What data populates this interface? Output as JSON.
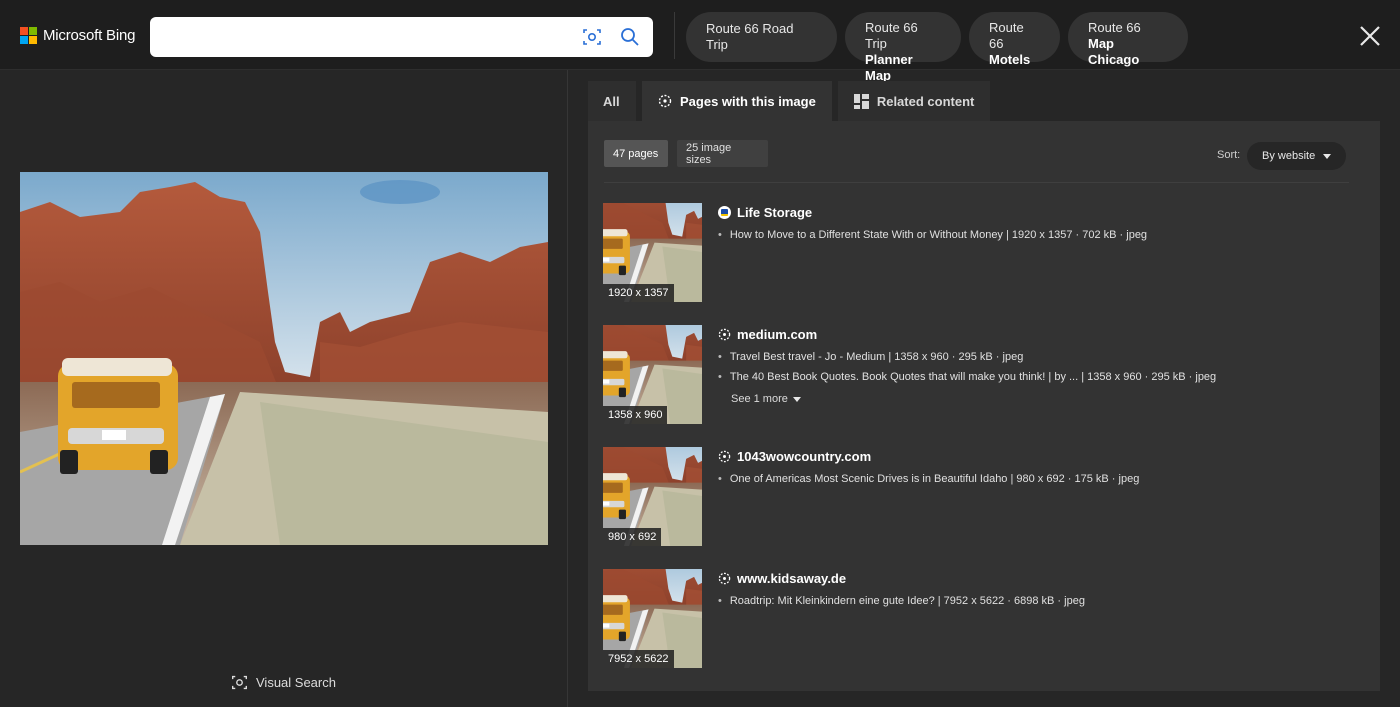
{
  "header": {
    "logo_text": "Microsoft Bing",
    "search_value": "",
    "chips": [
      {
        "line1": "Route 66 Road Trip",
        "line2": ""
      },
      {
        "line1": "Route 66 Trip",
        "line2": "Planner Map"
      },
      {
        "line1": "Route 66",
        "line2": "Motels"
      },
      {
        "line1": "Route 66",
        "line2": "Map Chicago"
      }
    ]
  },
  "left": {
    "visual_search_label": "Visual Search"
  },
  "tabs": {
    "all": "All",
    "pages": "Pages with this image",
    "related": "Related content"
  },
  "results": {
    "pages_pill": "47 pages",
    "sizes_pill": "25 image sizes",
    "sort_label": "Sort:",
    "sort_value": "By website",
    "items": [
      {
        "site": "Life Storage",
        "thumb_label": "1920 x 1357",
        "lines": [
          "How to Move to a Different State With or Without Money | 1920 x 1357 · 702 kB · jpeg"
        ]
      },
      {
        "site": "medium.com",
        "thumb_label": "1358 x 960",
        "lines": [
          "Travel Best travel - Jo - Medium | 1358 x 960 · 295 kB · jpeg",
          "The 40 Best Book Quotes. Book Quotes that will make you think! | by ... | 1358 x 960 · 295 kB · jpeg"
        ],
        "see_more": "See 1 more"
      },
      {
        "site": "1043wowcountry.com",
        "thumb_label": "980 x 692",
        "lines": [
          "One of Americas Most Scenic Drives is in Beautiful Idaho | 980 x 692 · 175 kB · jpeg"
        ]
      },
      {
        "site": "www.kidsaway.de",
        "thumb_label": "7952 x 5622",
        "lines": [
          "Roadtrip: Mit Kleinkindern eine gute Idee? | 7952 x 5622 · 6898 kB · jpeg"
        ]
      }
    ]
  }
}
